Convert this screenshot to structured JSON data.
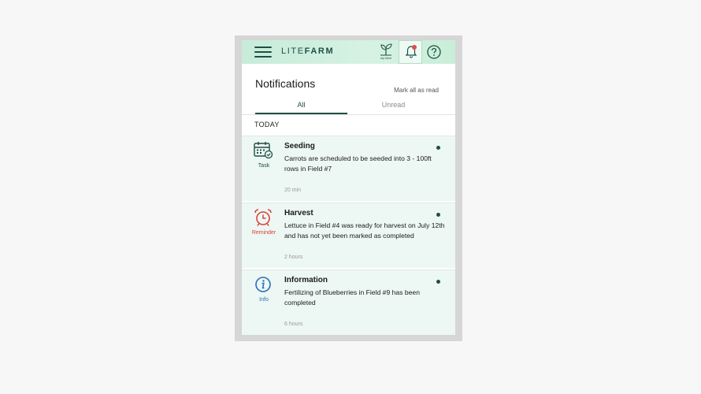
{
  "header": {
    "logo_part1": "LITE",
    "logo_part2": "FARM",
    "farm_label": "my farm"
  },
  "page": {
    "title": "Notifications",
    "mark_all_label": "Mark all as read"
  },
  "tabs": [
    {
      "label": "All",
      "active": true
    },
    {
      "label": "Unread",
      "active": false
    }
  ],
  "section_label": "TODAY",
  "notifications": [
    {
      "type": "Task",
      "icon": "calendar-check-icon",
      "type_color": "#1e4f45",
      "title": "Seeding",
      "body": "Carrots are scheduled to be seeded into 3 - 100ft rows in Field #7",
      "time": "20 min",
      "unread": true
    },
    {
      "type": "Reminder",
      "icon": "alarm-clock-icon",
      "type_color": "#d9423a",
      "title": "Harvest",
      "body": "Lettuce in Field #4  was ready for harvest on July 12th and has not yet been marked as completed",
      "time": "2 hours",
      "unread": true
    },
    {
      "type": "Info",
      "icon": "info-circle-icon",
      "type_color": "#2a6fb8",
      "title": "Information",
      "body": "Fertilizing of Blueberries in Field #9 has been completed",
      "time": "6 hours",
      "unread": true
    }
  ],
  "colors": {
    "brand": "#1e4f45",
    "header_bg": "#d6f2e3",
    "card_bg": "#edf7f4",
    "notification_badge": "#e04b4b"
  }
}
